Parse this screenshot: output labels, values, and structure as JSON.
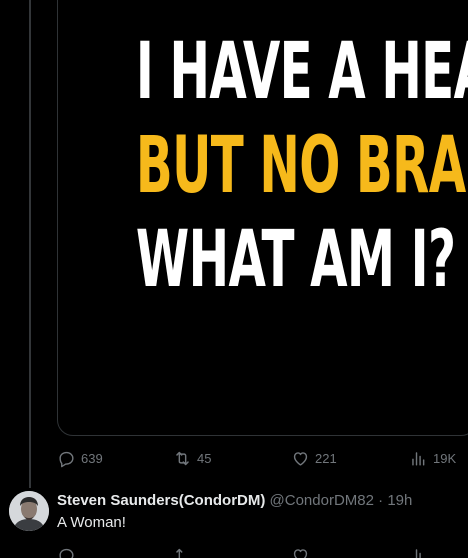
{
  "meme": {
    "line1": "I HAVE A HEAD,",
    "line2": "BUT NO BRAIN.",
    "line3": "WHAT AM I?",
    "colors": {
      "white": "#ffffff",
      "yellow": "#f6b91b"
    }
  },
  "tweet_actions": {
    "replies": "639",
    "retweets": "45",
    "likes": "221",
    "views": "19K",
    "icons": [
      "reply-icon",
      "retweet-icon",
      "like-icon",
      "views-icon"
    ]
  },
  "reply": {
    "name": "Steven Saunders(CondorDM)",
    "handle": "@CondorDM82",
    "separator": "·",
    "time": "19h",
    "text": "A Woman!"
  },
  "colors": {
    "background": "#000000",
    "text": "#e7e9ea",
    "muted": "#71767b",
    "border": "#2f3336"
  }
}
